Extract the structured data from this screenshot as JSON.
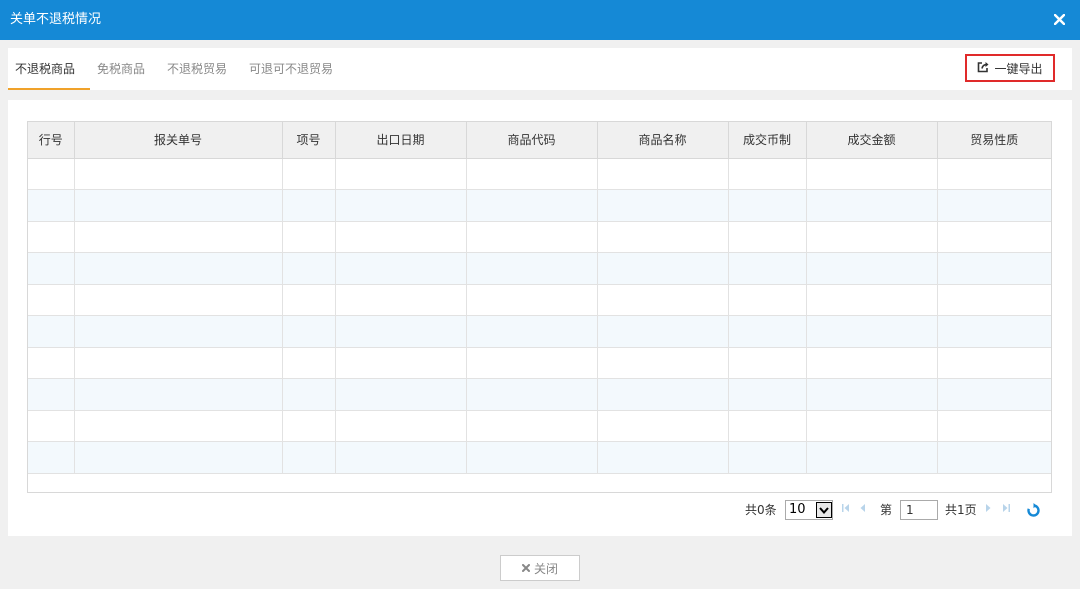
{
  "dialog": {
    "title": "关单不退税情况"
  },
  "tabs": [
    "不退税商品",
    "免税商品",
    "不退税贸易",
    "可退可不退贸易"
  ],
  "toolbar": {
    "export_label": "一键导出"
  },
  "table": {
    "columns": [
      "行号",
      "报关单号",
      "项号",
      "出口日期",
      "商品代码",
      "商品名称",
      "成交币制",
      "成交金额",
      "贸易性质"
    ],
    "rows": []
  },
  "pager": {
    "total": "共0条",
    "page_size": "10",
    "page_label": "第",
    "current_page": "1",
    "total_pages": "共1页"
  },
  "footer": {
    "close_label": "关闭"
  },
  "colors": {
    "header": "#1589d6",
    "tab_accent": "#f0a22a",
    "highlight_border": "#e02a2a",
    "row_alt": "#f3f9fd"
  }
}
